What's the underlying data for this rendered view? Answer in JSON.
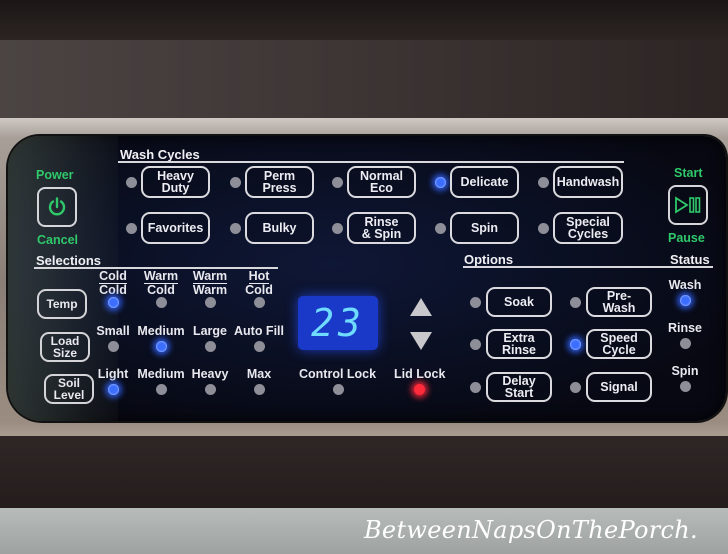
{
  "watermark": "BetweenNapsOnThePorch.",
  "left_controls": {
    "power_label": "Power",
    "cancel_label": "Cancel",
    "power_icon": "power-icon"
  },
  "right_controls": {
    "start_label": "Start",
    "pause_label": "Pause",
    "start_icon": "play-pause-icon"
  },
  "wash_cycles": {
    "header": "Wash Cycles",
    "items": [
      {
        "label_1": "Heavy",
        "label_2": "Duty",
        "selected": false
      },
      {
        "label_1": "Perm",
        "label_2": "Press",
        "selected": false
      },
      {
        "label_1": "Normal",
        "label_2": "Eco",
        "selected": false
      },
      {
        "label_1": "Delicate",
        "label_2": "",
        "selected": true
      },
      {
        "label_1": "Handwash",
        "label_2": "",
        "selected": false
      },
      {
        "label_1": "Favorites",
        "label_2": "",
        "selected": false
      },
      {
        "label_1": "Bulky",
        "label_2": "",
        "selected": false
      },
      {
        "label_1": "Rinse",
        "label_2": "& Spin",
        "selected": false
      },
      {
        "label_1": "Spin",
        "label_2": "",
        "selected": false
      },
      {
        "label_1": "Special",
        "label_2": "Cycles",
        "selected": false
      }
    ]
  },
  "selections": {
    "header": "Selections",
    "temp": {
      "button_label": "Temp",
      "options": [
        {
          "top": "Cold",
          "bottom": "Cold",
          "selected": true
        },
        {
          "top": "Warm",
          "bottom": "Cold",
          "selected": false
        },
        {
          "top": "Warm",
          "bottom": "Warm",
          "selected": false
        },
        {
          "top": "Hot",
          "bottom": "Cold",
          "selected": false
        }
      ]
    },
    "load_size": {
      "button_label_1": "Load",
      "button_label_2": "Size",
      "options": [
        {
          "label": "Small",
          "selected": false
        },
        {
          "label": "Medium",
          "selected": true
        },
        {
          "label": "Large",
          "selected": false
        },
        {
          "label": "Auto Fill",
          "selected": false
        }
      ]
    },
    "soil_level": {
      "button_label_1": "Soil",
      "button_label_2": "Level",
      "options": [
        {
          "label": "Light",
          "selected": true
        },
        {
          "label": "Medium",
          "selected": false
        },
        {
          "label": "Heavy",
          "selected": false
        },
        {
          "label": "Max",
          "selected": false
        }
      ]
    }
  },
  "display": {
    "value": "23",
    "control_lock_label": "Control Lock",
    "control_lock_on": false,
    "lid_lock_label": "Lid Lock",
    "lid_lock_on": true
  },
  "options": {
    "header": "Options",
    "items": [
      {
        "label_1": "Soak",
        "label_2": "",
        "selected": false
      },
      {
        "label_1": "Pre-",
        "label_2": "Wash",
        "selected": false
      },
      {
        "label_1": "Extra",
        "label_2": "Rinse",
        "selected": false
      },
      {
        "label_1": "Speed",
        "label_2": "Cycle",
        "selected": true
      },
      {
        "label_1": "Delay",
        "label_2": "Start",
        "selected": false
      },
      {
        "label_1": "Signal",
        "label_2": "",
        "selected": false
      }
    ]
  },
  "status": {
    "header": "Status",
    "items": [
      {
        "label": "Wash",
        "active": true
      },
      {
        "label": "Rinse",
        "active": false
      },
      {
        "label": "Spin",
        "active": false
      }
    ]
  },
  "colors": {
    "led_on": "#3b6dff",
    "led_off": "#8e8e98",
    "lid_lock_led": "#ff2a3a",
    "green_label": "#2fc86a",
    "display_bg": "#1b39c8",
    "display_digits": "#6fdcff"
  }
}
